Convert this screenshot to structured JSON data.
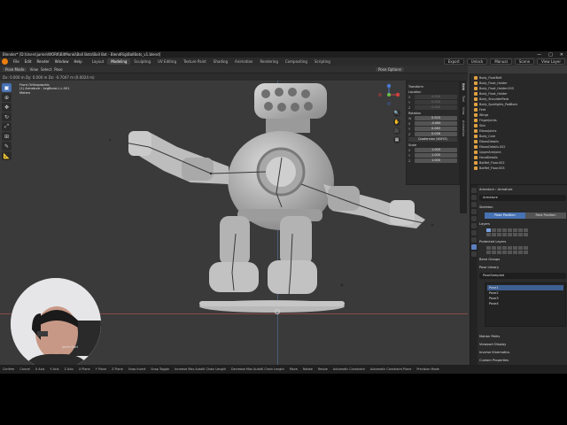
{
  "window": {
    "title": "Blender* [D:\\Users\\jamie\\WORK\\BitMonki\\Ball Bots\\Ball Bot - BlendRig\\BallBots_v1.blend]",
    "controls": [
      "—",
      "□",
      "✕"
    ]
  },
  "menubar": {
    "menus": [
      "File",
      "Edit",
      "Render",
      "Window",
      "Help"
    ],
    "workspaces": [
      "Layout",
      "Modeling",
      "Sculpting",
      "UV Editing",
      "Texture Paint",
      "Shading",
      "Animation",
      "Rendering",
      "Compositing",
      "Scripting"
    ],
    "active_workspace": "Modeling",
    "scene_label": "Scene",
    "view_layer_label": "View Layer",
    "chips": [
      "Export",
      "Unlock",
      "Manual"
    ]
  },
  "viewport_header": {
    "mode": "Pose Mode",
    "items": [
      "View",
      "Select",
      "Pose"
    ],
    "pose_options": "Pose Options",
    "tool_info": "Dx: 0.000 m  Dy: 0.000 m  Dz: -0.7047 m (0.0024 m)"
  },
  "viewport_info": {
    "view": "Front Orthographic",
    "object": "(1) Armature : LegBone.L.L.001",
    "units": "Meters"
  },
  "tools": [
    {
      "icon": "select-box-icon",
      "glyph": "▣",
      "active": true
    },
    {
      "icon": "cursor-icon",
      "glyph": "⊕",
      "active": false
    },
    {
      "icon": "move-icon",
      "glyph": "✥",
      "active": false
    },
    {
      "icon": "rotate-icon",
      "glyph": "↻",
      "active": false
    },
    {
      "icon": "scale-icon",
      "glyph": "⤢",
      "active": false
    },
    {
      "icon": "transform-icon",
      "glyph": "⊞",
      "active": false
    },
    {
      "icon": "annotate-icon",
      "glyph": "✎",
      "active": false
    },
    {
      "icon": "measure-icon",
      "glyph": "📐",
      "active": false
    }
  ],
  "nav_buttons": [
    "🔍",
    "✋",
    "🎥",
    "▦"
  ],
  "npanel": {
    "transform_title": "Transform",
    "location_title": "Location",
    "location": [
      "0.000",
      "0.000",
      "0.000"
    ],
    "rotation_title": "Rotation",
    "rotation": [
      "0.920",
      "-0.064",
      "0.083",
      "0.036"
    ],
    "rotation_keys": [
      "W",
      "X",
      "Y",
      "Z"
    ],
    "mode_label": "Quaternion (WXYZ)",
    "scale_title": "Scale",
    "scale": [
      "1.000",
      "1.000",
      "1.000"
    ],
    "axis_keys": [
      "X",
      "Y",
      "Z"
    ]
  },
  "side_tabs": [
    "Item",
    "Tool",
    "View",
    "Animation"
  ],
  "outliner": {
    "rows": [
      {
        "label": "Body_FloatBelt",
        "color": "#e0a040"
      },
      {
        "label": "Body_Float_Holder",
        "color": "#e0a040"
      },
      {
        "label": "Body_Float_Holder.003",
        "color": "#e0a040"
      },
      {
        "label": "Body_Float_Holder",
        "color": "#e0a040"
      },
      {
        "label": "Body_ShoulderPads",
        "color": "#e0a040"
      },
      {
        "label": "Body_Spotlights_PadBack",
        "color": "#e0a040"
      },
      {
        "label": "Feet",
        "color": "#e0a040"
      },
      {
        "label": "Wings",
        "color": "#e0a040"
      },
      {
        "label": "FingerJoints",
        "color": "#e0a040"
      },
      {
        "label": "Skin",
        "color": "#e0a040"
      },
      {
        "label": "ElbowJoints",
        "color": "#e0a040"
      },
      {
        "label": "Body_Core",
        "color": "#e0a040"
      },
      {
        "label": "ElbowDetails",
        "color": "#e0a040"
      },
      {
        "label": "ElbowDetails.002",
        "color": "#e0a040"
      },
      {
        "label": "UpperArmJoint",
        "color": "#e0a040"
      },
      {
        "label": "HandDetails",
        "color": "#e0a040"
      },
      {
        "label": "BotRef_Floor.002",
        "color": "#e0a040"
      },
      {
        "label": "BotRef_Floor.003",
        "color": "#e0a040"
      }
    ]
  },
  "properties": {
    "crumbs": "Armature  ›  Armature",
    "name": "Armature",
    "skeleton_title": "Skeleton",
    "pose_modes": [
      "Pose Position",
      "Rest Position"
    ],
    "active_pose_mode": "Pose Position",
    "layers_title": "Layers",
    "protected_title": "Protected Layers",
    "bone_groups": "Bone Groups",
    "pose_library": "Pose Library",
    "pose_lib_name": "PoseSampled",
    "poses": [
      "Pose1",
      "Pose2",
      "Pose3",
      "Pose4"
    ],
    "active_pose": "Pose1",
    "collapsed": [
      "Motion Paths",
      "Viewport Display",
      "Inverse Kinematics",
      "Custom Properties"
    ]
  },
  "statusbar": {
    "items": [
      "Confirm",
      "Cancel",
      "X Axis",
      "Y Axis",
      "Z Axis",
      "X Plane",
      "Y Plane",
      "Z Plane",
      "Snap Invert",
      "Snap Toggle",
      "Increase Max AutoIK Chain Length",
      "Decrease Max AutoIK Chain Length",
      "Move",
      "Rotate",
      "Resize",
      "Automatic Constraint",
      "Automatic Constraint Plane",
      "Precision Mode"
    ]
  },
  "webcam": {
    "caption": "Jamie Dutt"
  },
  "colors": {
    "accent": "#4772b3",
    "bone_line": "#3a3a3a",
    "model_grey": "#bdbdbd"
  }
}
